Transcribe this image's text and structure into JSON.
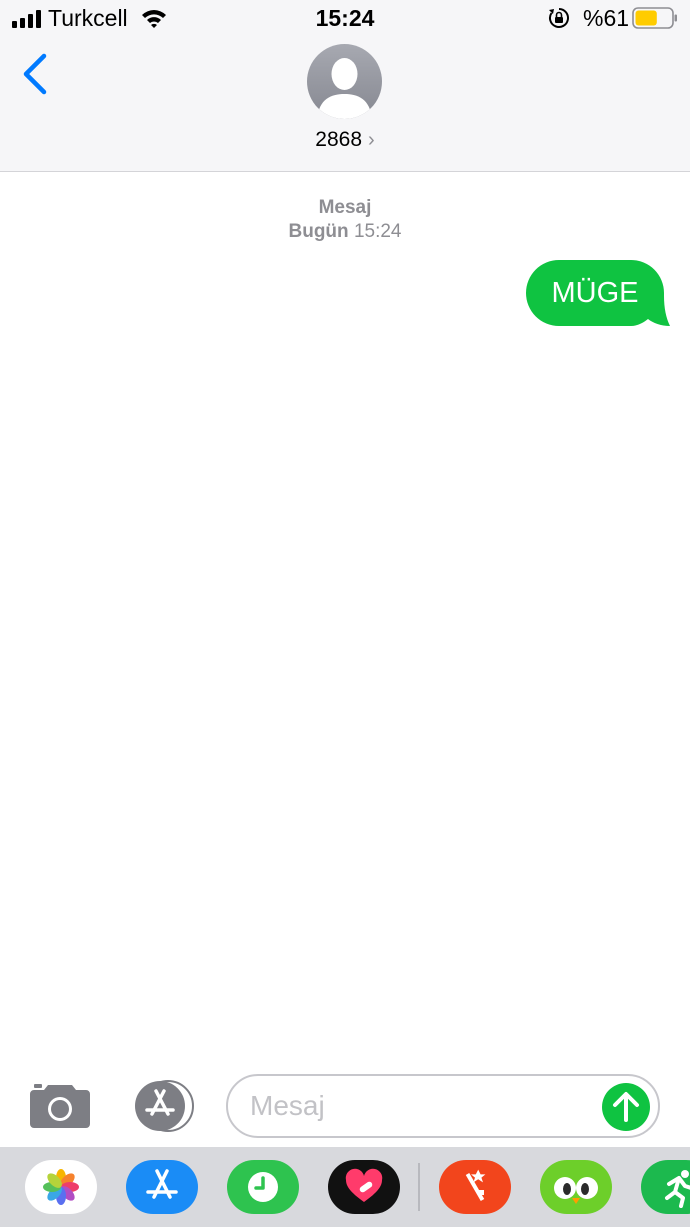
{
  "status_bar": {
    "carrier": "Turkcell",
    "time": "15:24",
    "battery_percent": "%61",
    "battery_level": 0.61,
    "battery_color": "#ffcc00"
  },
  "nav": {
    "back_icon": "chevron-left-icon",
    "contact_name": "2868",
    "contact_chevron": "›",
    "accent_color": "#007aff"
  },
  "conversation": {
    "service_label": "Mesaj",
    "day_label": "Bugün",
    "time_label": "15:24",
    "messages": [
      {
        "direction": "outgoing",
        "text": "MÜGE",
        "bubble_color": "#0fc341"
      }
    ]
  },
  "composer": {
    "placeholder": "Mesaj",
    "camera_icon": "camera-icon",
    "apps_icon": "app-store-icon",
    "send_icon": "arrow-up-icon",
    "send_color": "#0fc341"
  },
  "app_drawer": {
    "apps": [
      {
        "icon": "photos-icon"
      },
      {
        "icon": "app-store-icon"
      },
      {
        "icon": "clock-icon"
      },
      {
        "icon": "digital-touch-heart-icon"
      },
      {
        "icon": "video-effects-icon"
      },
      {
        "icon": "owl-app-icon"
      },
      {
        "icon": "activity-runner-icon"
      }
    ]
  }
}
